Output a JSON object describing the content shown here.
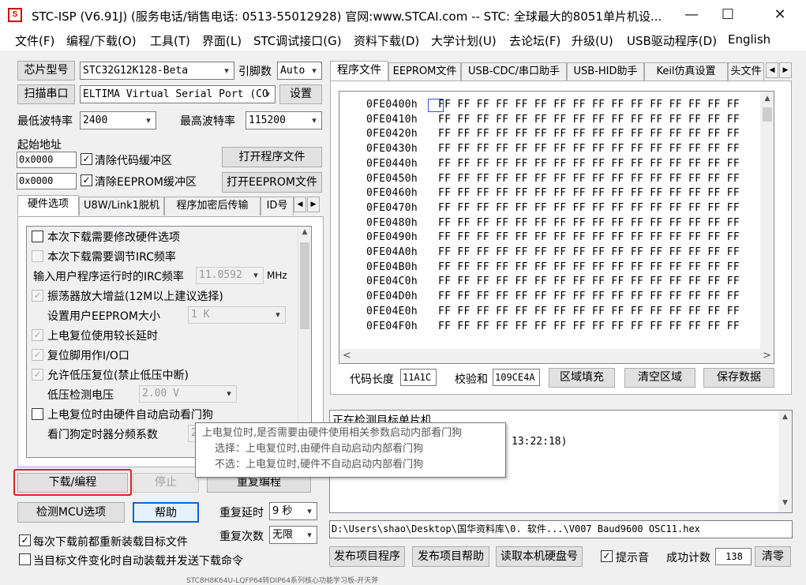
{
  "title": "STC-ISP (V6.91J) (服务电话/销售电话: 0513-55012928) 官网:www.STCAI.com  -- STC: 全球最大的8051单片机设...",
  "window_buttons": {
    "min": "—",
    "max": "☐",
    "close": "✕"
  },
  "menu": [
    "文件(F)",
    "编程/下载(O)",
    "工具(T)",
    "界面(L)",
    "STC调试接口(G)",
    "资料下载(D)",
    "大学计划(U)",
    "去论坛(F)",
    "升级(U)",
    "USB驱动程序(D)",
    "English"
  ],
  "left": {
    "chip_btn": "芯片型号",
    "chip_value": "STC32G12K128-Beta",
    "pins_label": "引脚数",
    "pins_value": "Auto",
    "scan_btn": "扫描串口",
    "port_value": "ELTIMA Virtual Serial Port (CO",
    "settings_btn": "设置",
    "min_baud_label": "最低波特率",
    "min_baud": "2400",
    "max_baud_label": "最高波特率",
    "max_baud": "115200",
    "start_addr_label": "起始地址",
    "addr1": "0x0000",
    "addr2": "0x0000",
    "clear_code": "清除代码缓冲区",
    "clear_eeprom": "清除EEPROM缓冲区",
    "open_prog": "打开程序文件",
    "open_eeprom": "打开EEPROM文件",
    "tabs": [
      "硬件选项",
      "U8W/Link1脱机",
      "程序加密后传输",
      "ID号"
    ],
    "options": {
      "o1": "本次下载需要修改硬件选项",
      "o2": "本次下载需要调节IRC频率",
      "irc_label": "输入用户程序运行时的IRC频率",
      "irc_value": "11.0592",
      "irc_unit": "MHz",
      "o3": "振荡器放大增益(12M以上建议选择)",
      "eeprom_label": "设置用户EEPROM大小",
      "eeprom_value": "1   K",
      "o4": "上电复位使用较长延时",
      "o5": "复位脚用作I/O口",
      "o6": "允许低压复位(禁止低压中断)",
      "lv_label": "低压检测电压",
      "lv_value": "2.00 V",
      "o7": "上电复位时由硬件自动启动看门狗",
      "wdt_label": "看门狗定时器分频系数",
      "wdt_value": "2"
    },
    "download_btn": "下载/编程",
    "stop_btn": "停止",
    "repeat_btn": "重复编程",
    "check_btn": "检测MCU选项",
    "help_btn": "帮助",
    "delay_label": "重复延时",
    "delay_value": "9 秒",
    "count_label": "重复次数",
    "count_value": "无限",
    "reload_chk": "每次下载前都重新装载目标文件",
    "auto_chk": "当目标文件变化时自动装载并发送下载命令"
  },
  "right": {
    "tabs": [
      "程序文件",
      "EEPROM文件",
      "USB-CDC/串口助手",
      "USB-HID助手",
      "Keil仿真设置",
      "头文件"
    ],
    "hex_rows": [
      {
        "addr": "0FE0400h",
        "bytes": "FF FF FF FF FF FF FF FF FF FF FF FF FF FF FF FF"
      },
      {
        "addr": "0FE0410h",
        "bytes": "FF FF FF FF FF FF FF FF FF FF FF FF FF FF FF FF"
      },
      {
        "addr": "0FE0420h",
        "bytes": "FF FF FF FF FF FF FF FF FF FF FF FF FF FF FF FF"
      },
      {
        "addr": "0FE0430h",
        "bytes": "FF FF FF FF FF FF FF FF FF FF FF FF FF FF FF FF"
      },
      {
        "addr": "0FE0440h",
        "bytes": "FF FF FF FF FF FF FF FF FF FF FF FF FF FF FF FF"
      },
      {
        "addr": "0FE0450h",
        "bytes": "FF FF FF FF FF FF FF FF FF FF FF FF FF FF FF FF"
      },
      {
        "addr": "0FE0460h",
        "bytes": "FF FF FF FF FF FF FF FF FF FF FF FF FF FF FF FF"
      },
      {
        "addr": "0FE0470h",
        "bytes": "FF FF FF FF FF FF FF FF FF FF FF FF FF FF FF FF"
      },
      {
        "addr": "0FE0480h",
        "bytes": "FF FF FF FF FF FF FF FF FF FF FF FF FF FF FF FF"
      },
      {
        "addr": "0FE0490h",
        "bytes": "FF FF FF FF FF FF FF FF FF FF FF FF FF FF FF FF"
      },
      {
        "addr": "0FE04A0h",
        "bytes": "FF FF FF FF FF FF FF FF FF FF FF FF FF FF FF FF"
      },
      {
        "addr": "0FE04B0h",
        "bytes": "FF FF FF FF FF FF FF FF FF FF FF FF FF FF FF FF"
      },
      {
        "addr": "0FE04C0h",
        "bytes": "FF FF FF FF FF FF FF FF FF FF FF FF FF FF FF FF"
      },
      {
        "addr": "0FE04D0h",
        "bytes": "FF FF FF FF FF FF FF FF FF FF FF FF FF FF FF FF"
      },
      {
        "addr": "0FE04E0h",
        "bytes": "FF FF FF FF FF FF FF FF FF FF FF FF FF FF FF FF"
      },
      {
        "addr": "0FE04F0h",
        "bytes": "FF FF FF FF FF FF FF FF FF FF FF FF FF FF FF FF"
      }
    ],
    "code_len_label": "代码长度",
    "code_len": "11A1C",
    "checksum_label": "校验和",
    "checksum": "109CE4A",
    "fill_btn": "区域填充",
    "clear_btn": "清空区域",
    "save_btn": "保存数据",
    "log_line1": "正在检测目标单片机 ...",
    "log_line2": "13:22:18)",
    "path": "D:\\Users\\shao\\Desktop\\国华资料库\\0. 软件...\\V007 Baud9600 OSC11.hex",
    "publish_btn": "发布项目程序",
    "publish_help_btn": "发布项目帮助",
    "read_disk_btn": "读取本机硬盘号",
    "beep_chk": "提示音",
    "success_label": "成功计数",
    "success_count": "138",
    "reset_btn": "清零"
  },
  "tooltip": {
    "line1": "上电复位时,是否需要由硬件使用相关参数启动内部看门狗",
    "line2": "选择：上电复位时,由硬件自动启动内部看门狗",
    "line3": "不选：上电复位时,硬件不自动启动内部看门狗"
  },
  "footer_text": "STC8H8K64U-LQFP64转DIP64系列核心功能学习板-开天斧",
  "colors": {
    "highlight": "#e02020",
    "focus": "#0a64d4"
  }
}
